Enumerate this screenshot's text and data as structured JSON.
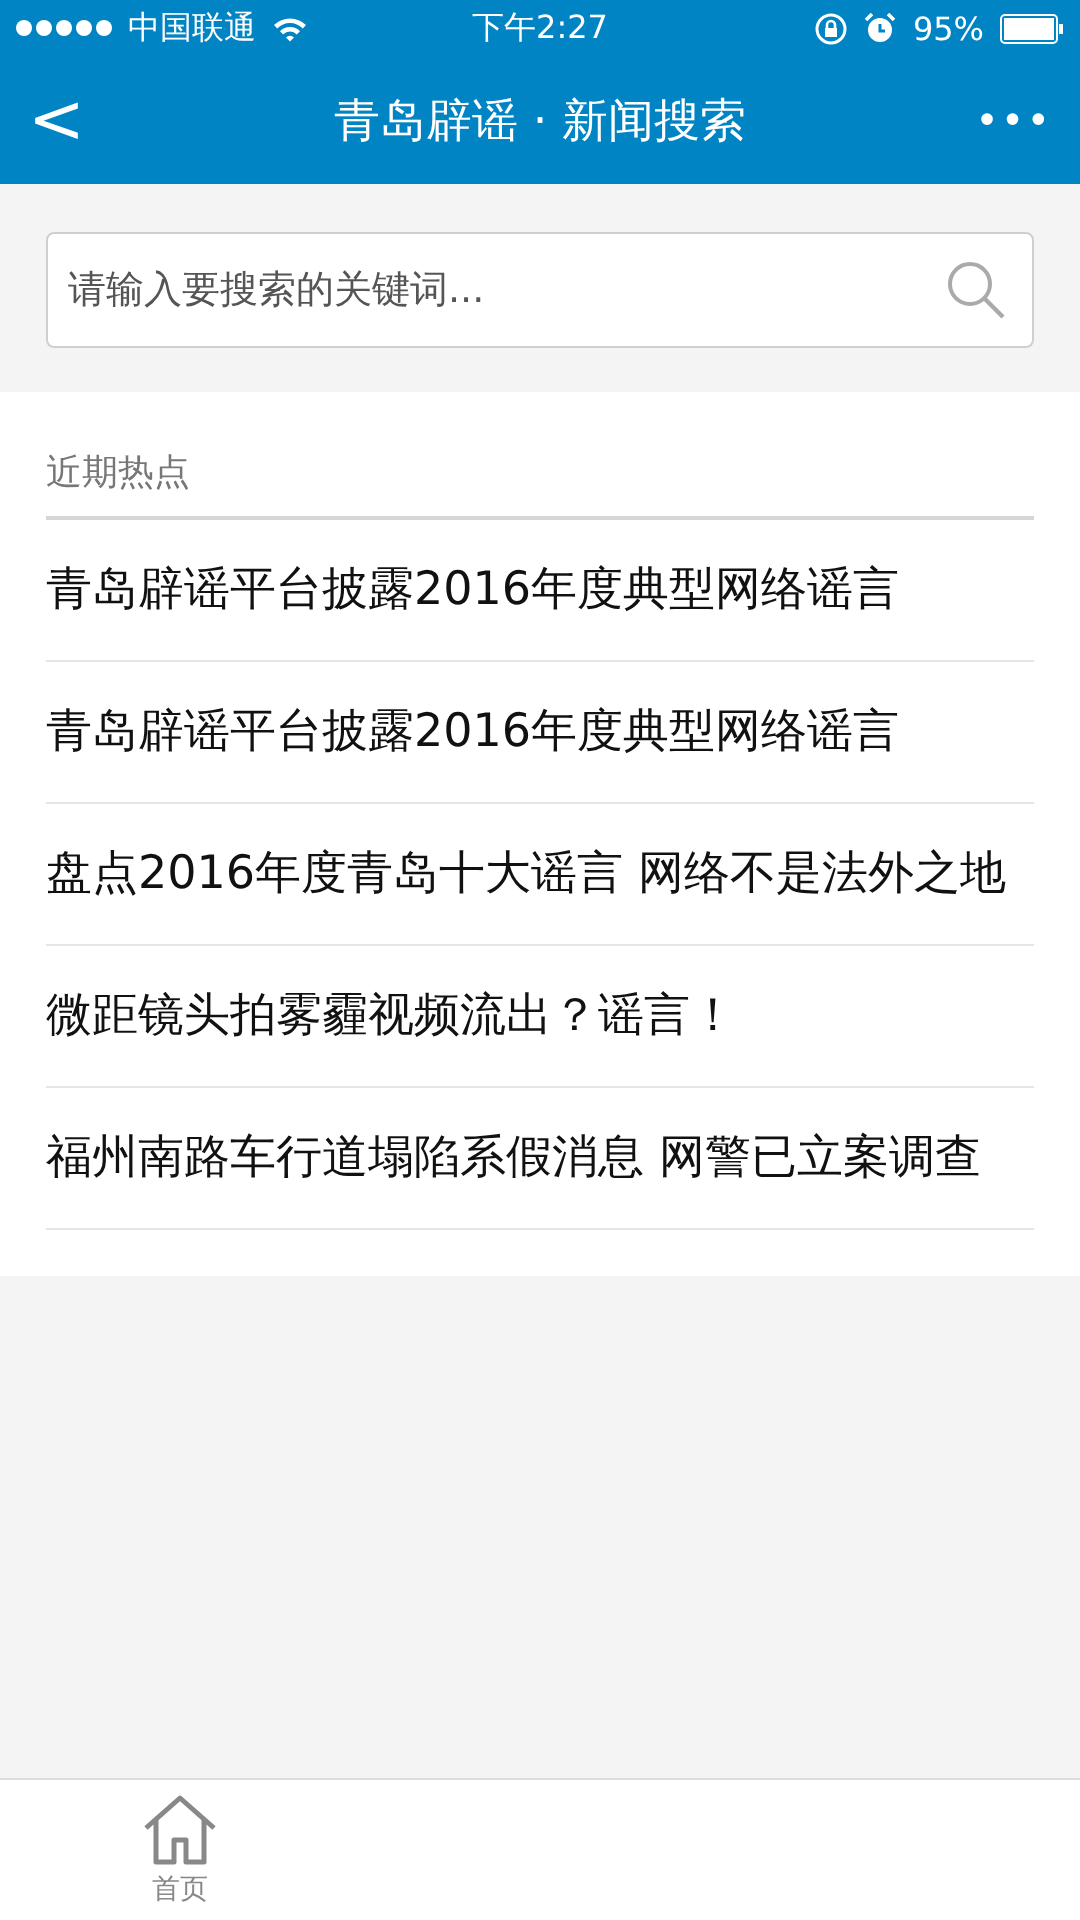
{
  "status_bar": {
    "carrier": "中国联通",
    "time": "下午2:27",
    "battery": "95%"
  },
  "nav_bar": {
    "back": "<",
    "title": "青岛辟谣 · 新闻搜索",
    "more": "•••"
  },
  "search": {
    "placeholder": "请输入要搜索的关键词..."
  },
  "hot": {
    "heading": "近期热点",
    "items": [
      {
        "title": "青岛辟谣平台披露2016年度典型网络谣言"
      },
      {
        "title": "青岛辟谣平台披露2016年度典型网络谣言"
      },
      {
        "title": "盘点2016年度青岛十大谣言 网络不是法外之地"
      },
      {
        "title": "微距镜头拍雾霾视频流出？谣言！"
      },
      {
        "title": "福州南路车行道塌陷系假消息 网警已立案调查"
      }
    ]
  },
  "tab_bar": [
    {
      "label": "首页",
      "selected": false
    }
  ]
}
